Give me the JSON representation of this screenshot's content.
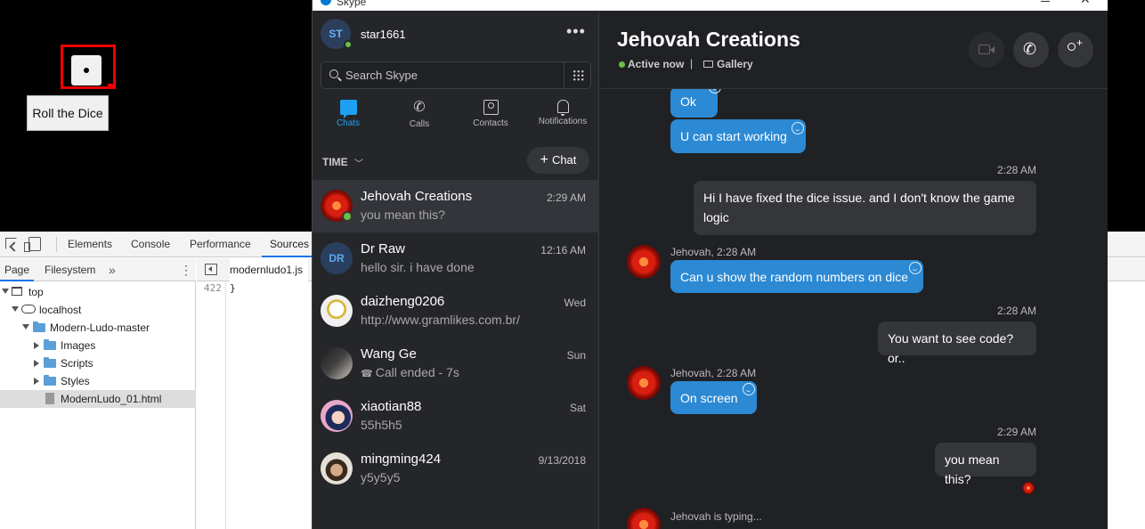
{
  "game": {
    "roll_button_label": "Roll the Dice"
  },
  "devtools": {
    "tabs": [
      {
        "label": "Elements"
      },
      {
        "label": "Console"
      },
      {
        "label": "Performance"
      },
      {
        "label": "Sources",
        "active": true
      }
    ],
    "navigator": {
      "tabs": [
        {
          "label": "Page",
          "active": true
        },
        {
          "label": "Filesystem"
        }
      ],
      "more_label": "»",
      "tree": [
        {
          "label": "top"
        },
        {
          "label": "localhost"
        },
        {
          "label": "Modern-Ludo-master"
        },
        {
          "label": "Images"
        },
        {
          "label": "Scripts"
        },
        {
          "label": "Styles"
        },
        {
          "label": "ModernLudo_01.html",
          "selected": true
        }
      ]
    },
    "editor": {
      "file_tab": "modernludo1.js",
      "line_number": "422",
      "code_line": "}"
    }
  },
  "skype": {
    "app_title": "Skype",
    "profile": {
      "initials": "ST",
      "name": "star1661"
    },
    "search": {
      "placeholder": "Search Skype"
    },
    "nav": [
      {
        "label": "Chats",
        "active": true
      },
      {
        "label": "Calls"
      },
      {
        "label": "Contacts"
      },
      {
        "label": "Notifications"
      }
    ],
    "sort_label": "TIME",
    "new_chat_label": "Chat",
    "conversations": [
      {
        "name": "Jehovah Creations",
        "preview": "you mean this?",
        "time": "2:29 AM",
        "active": true,
        "online": true
      },
      {
        "name": "Dr Raw",
        "preview": "hello sir. i have done",
        "time": "12:16 AM",
        "initials": "DR"
      },
      {
        "name": "daizheng0206",
        "preview": "http://www.gramlikes.com.br/",
        "time": "Wed"
      },
      {
        "name": "Wang Ge",
        "preview": "Call ended - 7s",
        "time": "Sun"
      },
      {
        "name": "xiaotian88",
        "preview": "55h5h5",
        "time": "Sat"
      },
      {
        "name": "mingming424",
        "preview": "y5y5y5",
        "time": "9/13/2018"
      }
    ],
    "chat": {
      "title": "Jehovah Creations",
      "status": "Active now",
      "separator": "|",
      "gallery_label": "Gallery",
      "messages": [
        {
          "text": "Ok",
          "direction": "in"
        },
        {
          "text": "U can start working",
          "direction": "in"
        },
        {
          "time": "2:28 AM",
          "text": "Hi I have fixed the dice issue. and I don't know the game logic",
          "direction": "out"
        },
        {
          "sender": "Jehovah, 2:28 AM",
          "text": "Can u show the random numbers on dice",
          "direction": "in"
        },
        {
          "time": "2:28 AM",
          "text": "You want to see code? or..",
          "direction": "out"
        },
        {
          "sender": "Jehovah, 2:28 AM",
          "text": "On screen",
          "direction": "in"
        },
        {
          "time": "2:29 AM",
          "text": "you mean this?",
          "direction": "out"
        }
      ],
      "typing": "Jehovah is typing..."
    }
  }
}
